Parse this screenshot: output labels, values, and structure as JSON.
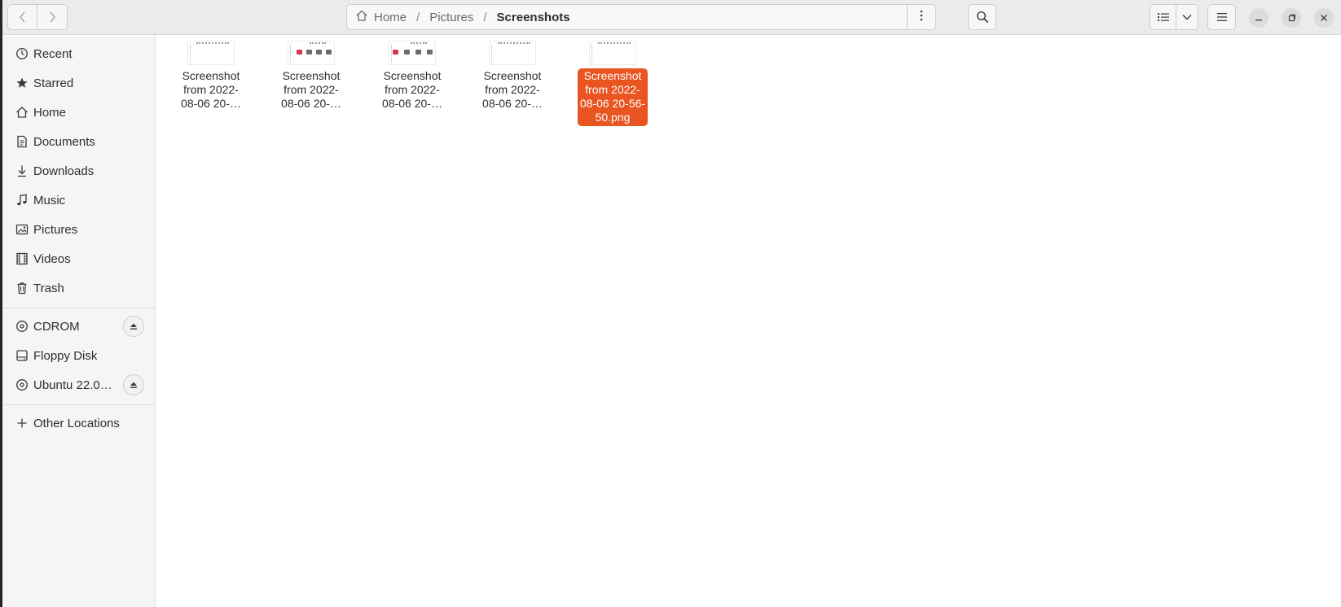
{
  "window": {
    "accent_color": "#e95420"
  },
  "pathbar": {
    "crumbs": [
      "Home",
      "Pictures",
      "Screenshots"
    ],
    "separator": "/"
  },
  "sidebar": {
    "places": [
      {
        "label": "Recent",
        "icon": "clock-icon"
      },
      {
        "label": "Starred",
        "icon": "star-icon"
      },
      {
        "label": "Home",
        "icon": "home-icon"
      },
      {
        "label": "Documents",
        "icon": "document-icon"
      },
      {
        "label": "Downloads",
        "icon": "download-icon"
      },
      {
        "label": "Music",
        "icon": "music-icon"
      },
      {
        "label": "Pictures",
        "icon": "picture-icon"
      },
      {
        "label": "Videos",
        "icon": "film-icon"
      },
      {
        "label": "Trash",
        "icon": "trash-icon"
      }
    ],
    "devices": [
      {
        "label": "CDROM",
        "icon": "disc-icon",
        "ejectable": true
      },
      {
        "label": "Floppy Disk",
        "icon": "drive-icon",
        "ejectable": false
      },
      {
        "label": "Ubuntu 22.0…",
        "icon": "disc-icon",
        "ejectable": true
      }
    ],
    "other": {
      "label": "Other Locations",
      "icon": "plus-icon"
    }
  },
  "files": [
    {
      "line1": "Screenshot",
      "line2": "from 2022-",
      "line3": "08-06 20-…",
      "line4": "",
      "selected": false
    },
    {
      "line1": "Screenshot",
      "line2": "from 2022-",
      "line3": "08-06 20-…",
      "line4": "",
      "selected": false
    },
    {
      "line1": "Screenshot",
      "line2": "from 2022-",
      "line3": "08-06 20-…",
      "line4": "",
      "selected": false
    },
    {
      "line1": "Screenshot",
      "line2": "from 2022-",
      "line3": "08-06 20-…",
      "line4": "",
      "selected": false
    },
    {
      "line1": "Screenshot",
      "line2": "from 2022-",
      "line3": "08-06 20-56-",
      "line4": "50.png",
      "selected": true
    }
  ]
}
